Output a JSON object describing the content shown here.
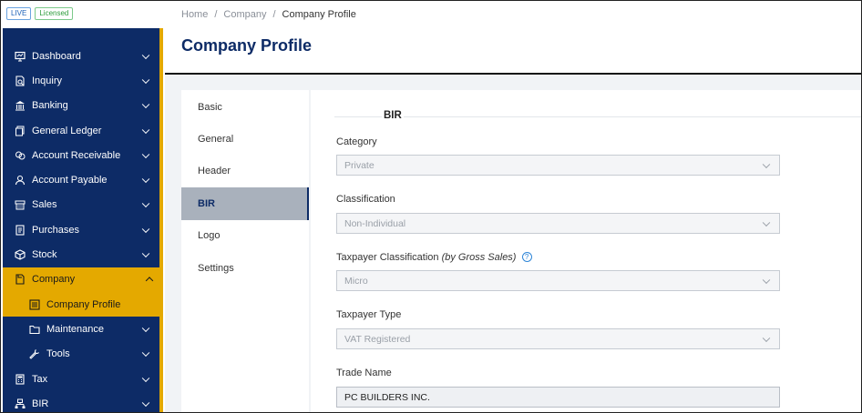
{
  "badges": {
    "live": "LIVE",
    "licensed": "Licensed"
  },
  "sidebar": {
    "items": [
      {
        "label": "Dashboard",
        "icon": "monitor-icon"
      },
      {
        "label": "Inquiry",
        "icon": "document-search-icon"
      },
      {
        "label": "Banking",
        "icon": "bank-icon"
      },
      {
        "label": "General Ledger",
        "icon": "ledger-icon"
      },
      {
        "label": "Account Receivable",
        "icon": "receivable-icon"
      },
      {
        "label": "Account Payable",
        "icon": "user-icon"
      },
      {
        "label": "Sales",
        "icon": "register-icon"
      },
      {
        "label": "Purchases",
        "icon": "receipt-icon"
      },
      {
        "label": "Stock",
        "icon": "cube-icon"
      },
      {
        "label": "Company",
        "icon": "file-icon"
      },
      {
        "label": "Company Profile",
        "icon": "list-icon"
      },
      {
        "label": "Maintenance",
        "icon": "folder-icon"
      },
      {
        "label": "Tools",
        "icon": "wrench-icon"
      },
      {
        "label": "Tax",
        "icon": "calculator-icon"
      },
      {
        "label": "BIR",
        "icon": "network-icon"
      }
    ]
  },
  "breadcrumb": {
    "home": "Home",
    "sep": "/",
    "company": "Company",
    "current": "Company Profile"
  },
  "page": {
    "title": "Company Profile"
  },
  "tabs": [
    "Basic",
    "General",
    "Header",
    "BIR",
    "Logo",
    "Settings"
  ],
  "form": {
    "section_title": "BIR",
    "category": {
      "label": "Category",
      "value": "Private"
    },
    "classification": {
      "label": "Classification",
      "value": "Non-Individual"
    },
    "taxpayer_classification": {
      "label": "Taxpayer Classification",
      "label_suffix": "(by Gross Sales)",
      "help": "?",
      "value": "Micro"
    },
    "taxpayer_type": {
      "label": "Taxpayer Type",
      "value": "VAT Registered"
    },
    "trade_name": {
      "label": "Trade Name",
      "value": "PC BUILDERS INC."
    }
  },
  "colors": {
    "nav_bg": "#0d2b66",
    "accent": "#e4a900",
    "title": "#0d2b66"
  }
}
